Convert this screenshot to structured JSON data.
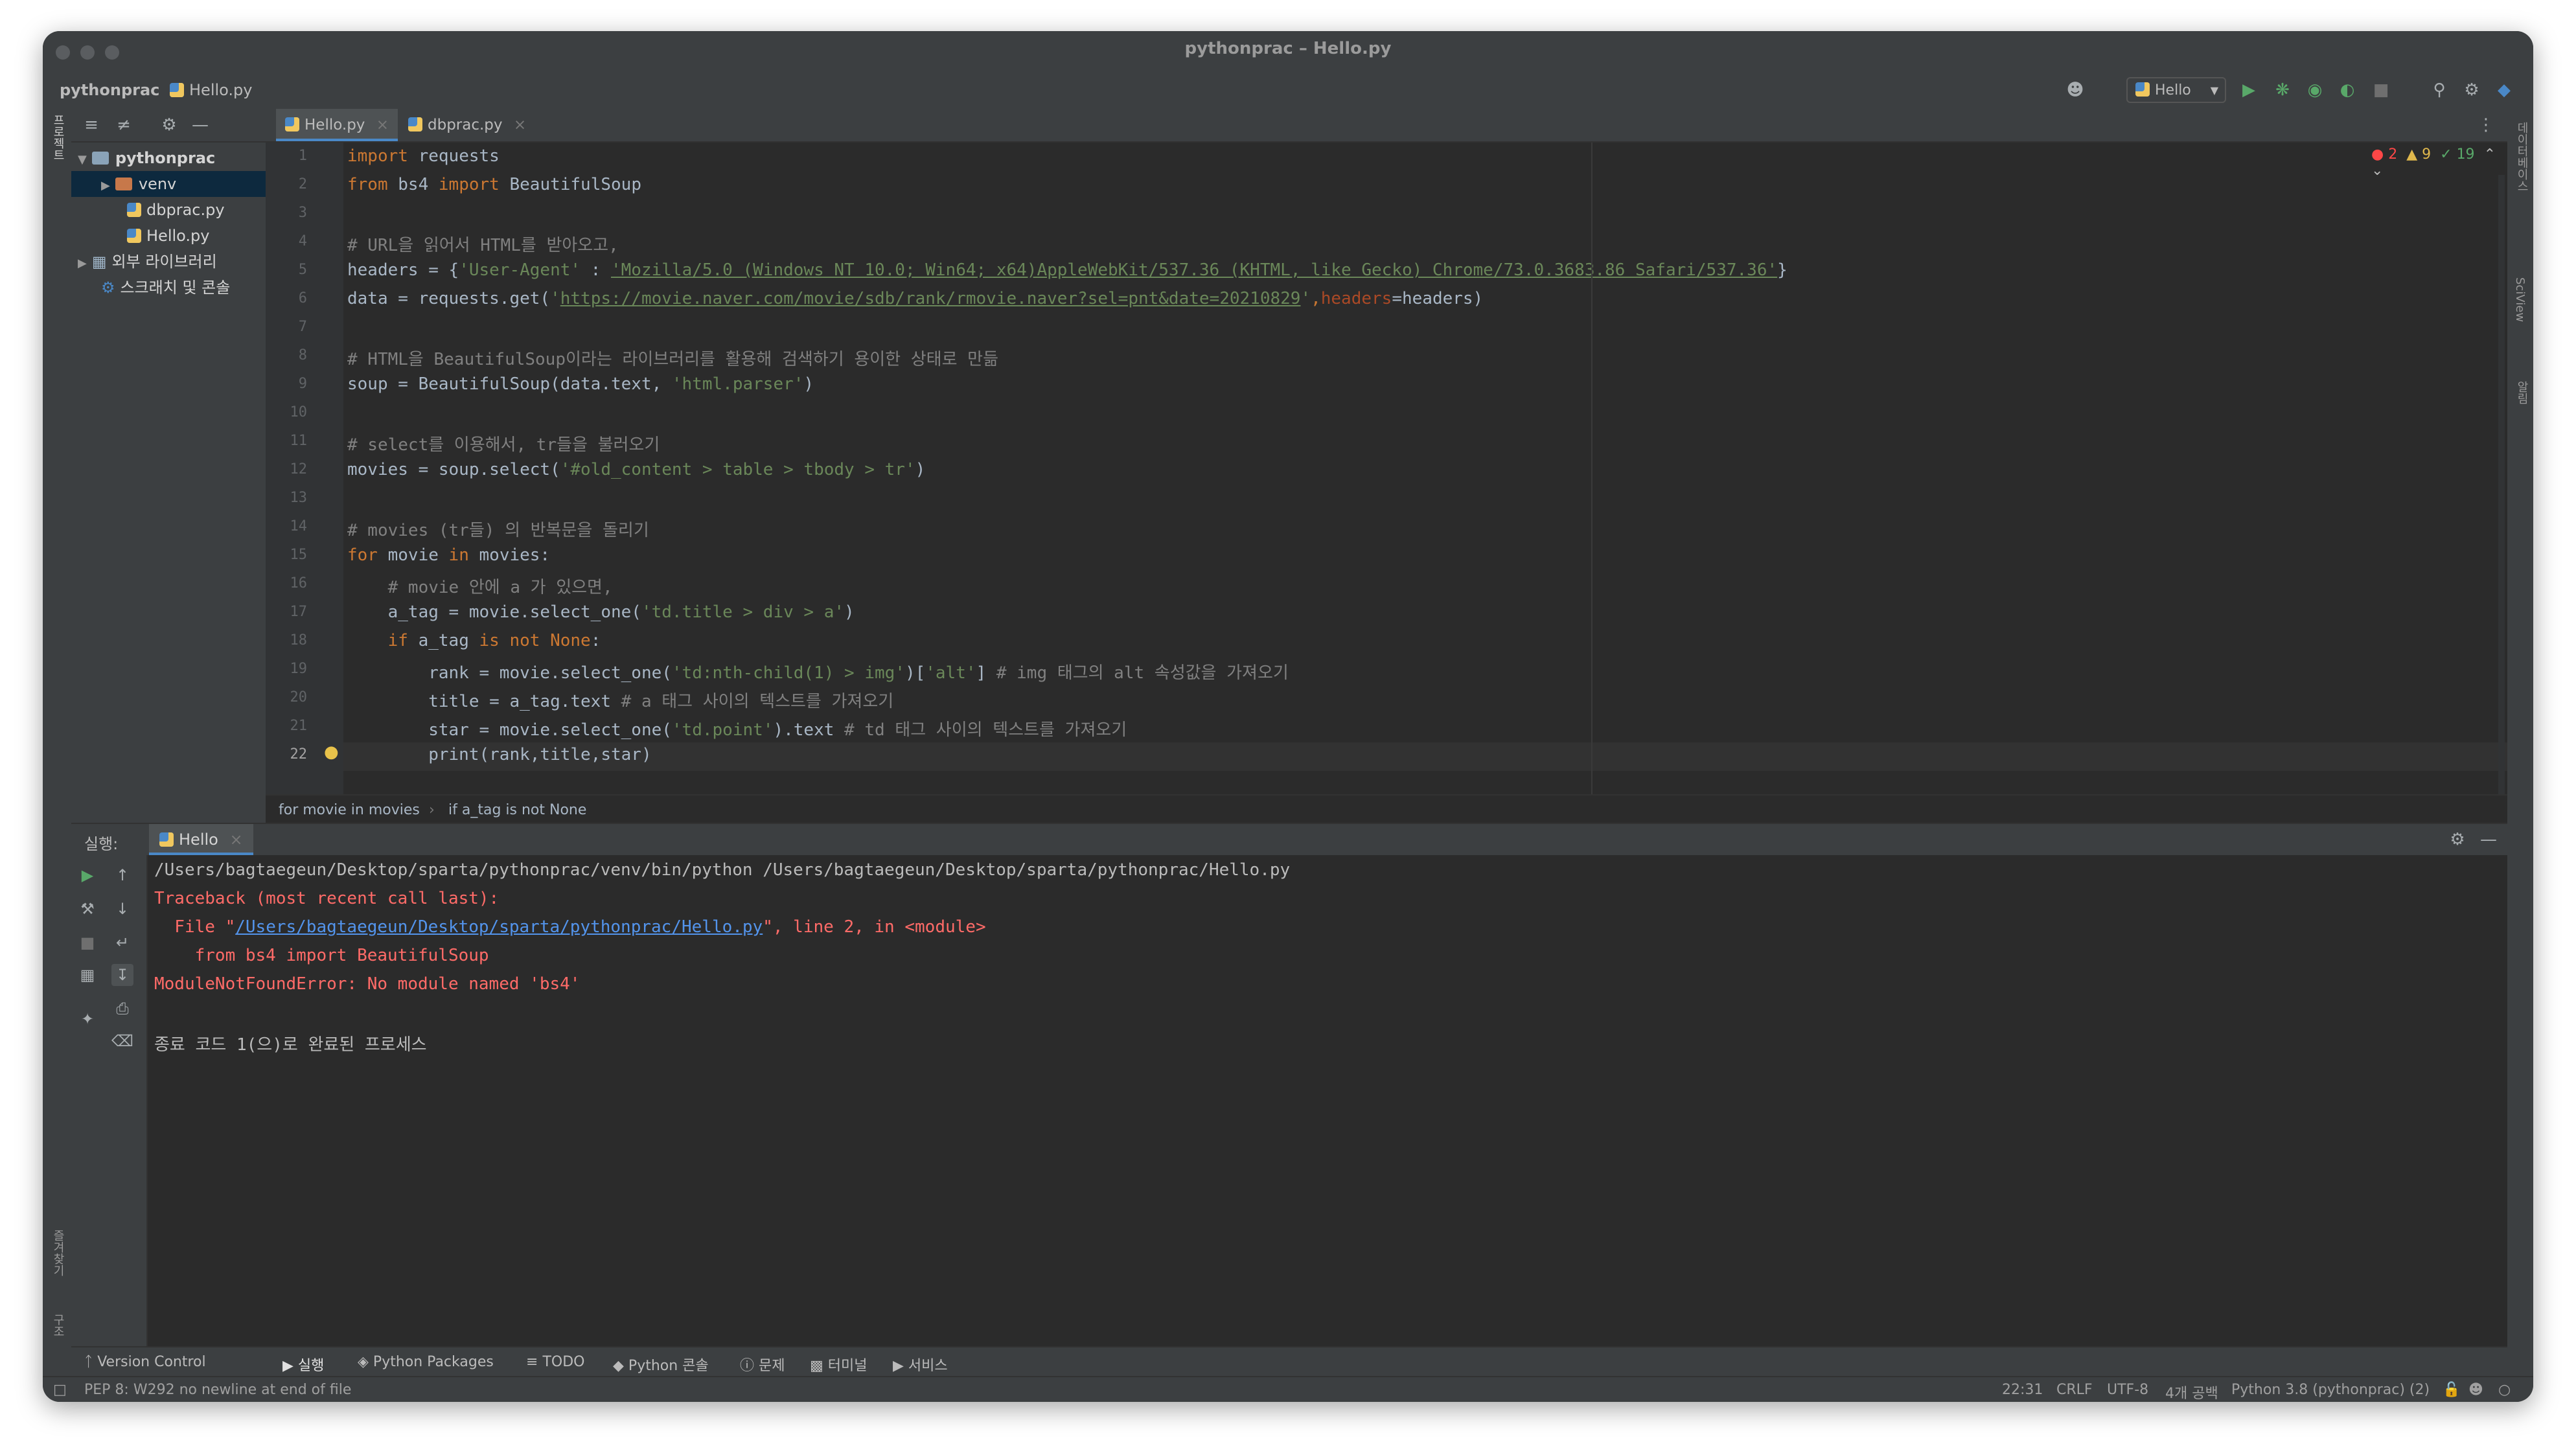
{
  "window": {
    "title": "pythonprac – Hello.py"
  },
  "navbar": {
    "project": "pythonprac",
    "file": "Hello.py",
    "run_config": "Hello"
  },
  "project_tree": {
    "items": [
      {
        "label": "pythonprac",
        "kind": "folder"
      },
      {
        "label": "venv",
        "kind": "folder-orange"
      },
      {
        "label": "dbprac.py",
        "kind": "py"
      },
      {
        "label": "Hello.py",
        "kind": "py"
      },
      {
        "label": "외부 라이브러리",
        "kind": "lib"
      },
      {
        "label": "스크래치 및 콘솔",
        "kind": "scratch"
      }
    ]
  },
  "left_strip": {
    "top_label": "프로젝트",
    "bottom_label_1": "즐겨찾기",
    "bottom_label_2": "구조"
  },
  "right_strip": {
    "label_1": "데이터베이스",
    "label_2": "SciView",
    "label_3": "알림"
  },
  "tabs": [
    {
      "label": "Hello.py",
      "active": true
    },
    {
      "label": "dbprac.py",
      "active": false
    }
  ],
  "inspections": {
    "errors": "2",
    "warnings": "9",
    "ok": "19"
  },
  "editor": {
    "lines": [
      "1",
      "2",
      "3",
      "4",
      "5",
      "6",
      "7",
      "8",
      "9",
      "10",
      "11",
      "12",
      "13",
      "14",
      "15",
      "16",
      "17",
      "18",
      "19",
      "20",
      "21",
      "22"
    ],
    "current_line": "22",
    "code": {
      "l1_kw": "import",
      "l1_rest": " requests",
      "l2_kw1": "from",
      "l2_mod": " bs4 ",
      "l2_kw2": "import",
      "l2_rest": " BeautifulSoup",
      "l4": "# URL을 읽어서 HTML를 받아오고,",
      "l5_pre": "headers = {",
      "l5_key": "'User-Agent'",
      "l5_colon": " : ",
      "l5_val": "'Mozilla/5.0 (Windows NT 10.0; Win64; x64)AppleWebKit/537.36 (KHTML, like Gecko) Chrome/73.0.3683.86 Safari/537.36'",
      "l5_end": "}",
      "l6_pre": "data = requests.get(",
      "l6_q": "'",
      "l6_url": "https://movie.naver.com/movie/sdb/rank/rmovie.naver?sel=pnt&date=20210829",
      "l6_q2": "'",
      "l6_comma": ",",
      "l6_param": "headers",
      "l6_end": "=headers)",
      "l8": "# HTML을 BeautifulSoup이라는 라이브러리를 활용해 검색하기 용이한 상태로 만듦",
      "l9_pre": "soup = BeautifulSoup(data.text, ",
      "l9_str": "'html.parser'",
      "l9_end": ")",
      "l11": "# select를 이용해서, tr들을 불러오기",
      "l12_pre": "movies = soup.select(",
      "l12_str": "'#old_content > table > tbody > tr'",
      "l12_end": ")",
      "l14": "# movies (tr들) 의 반복문을 돌리기",
      "l15_kw1": "for",
      "l15_mid": " movie ",
      "l15_kw2": "in",
      "l15_end": " movies:",
      "l16": "    # movie 안에 a 가 있으면,",
      "l17_pre": "    a_tag = movie.select_one(",
      "l17_str": "'td.title > div > a'",
      "l17_end": ")",
      "l18_pre": "    ",
      "l18_kw1": "if",
      "l18_mid": " a_tag ",
      "l18_kw2": "is not None",
      "l18_end": ":",
      "l19_pre": "        rank = movie.select_one(",
      "l19_str": "'td:nth-child(1) > img'",
      "l19_mid": ")[",
      "l19_str2": "'alt'",
      "l19_end": "]",
      "l19_cm": " # img 태그의 alt 속성값을 가져오기",
      "l20_pre": "        title = a_tag.text",
      "l20_cm": " # a 태그 사이의 텍스트를 가져오기",
      "l21_pre": "        star = movie.select_one(",
      "l21_str": "'td.point'",
      "l21_end": ").text",
      "l21_cm": " # td 태그 사이의 텍스트를 가져오기",
      "l22": "        print(rank,title,star)"
    }
  },
  "breadcrumb": {
    "item1": "for movie in movies",
    "item2": "if a_tag is not None"
  },
  "run_panel": {
    "label": "실행:",
    "tab": "Hello",
    "console": {
      "cmd": "/Users/bagtaegeun/Desktop/sparta/pythonprac/venv/bin/python /Users/bagtaegeun/Desktop/sparta/pythonprac/Hello.py",
      "tb1": "Traceback (most recent call last):",
      "tb2_pre": "  File \"",
      "tb2_link": "/Users/bagtaegeun/Desktop/sparta/pythonprac/Hello.py",
      "tb2_post": "\", line 2, in <module>",
      "tb3": "    from bs4 import BeautifulSoup",
      "tb4": "ModuleNotFoundError: No module named 'bs4'",
      "exit": "종료 코드 1(으)로 완료된 프로세스"
    }
  },
  "bottom_tabs": [
    "Version Control",
    "실행",
    "Python Packages",
    "TODO",
    "Python 콘솔",
    "문제",
    "터미널",
    "서비스"
  ],
  "status_bar": {
    "message": "PEP 8: W292 no newline at end of file",
    "position": "22:31",
    "line_sep": "CRLF",
    "encoding": "UTF-8",
    "indent": "4개 공백",
    "interpreter": "Python 3.8 (pythonprac) (2)"
  }
}
